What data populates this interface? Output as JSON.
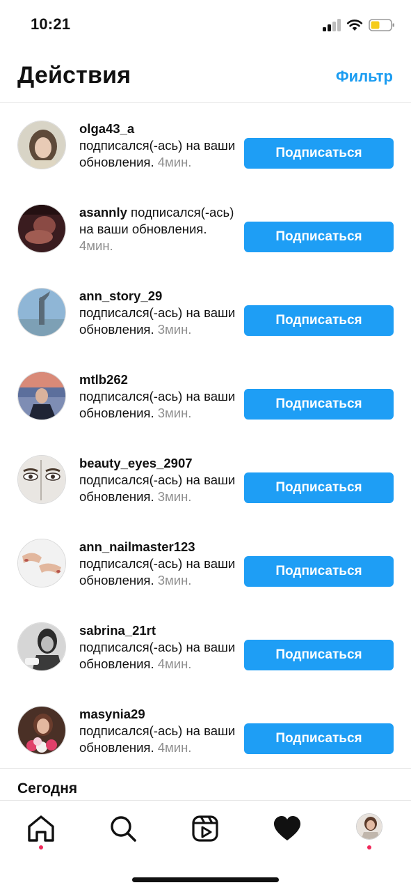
{
  "status_bar": {
    "time": "10:21",
    "icons": [
      "cellular-signal-icon",
      "wifi-icon",
      "battery-icon"
    ],
    "battery_color": "#f5cc1a"
  },
  "header": {
    "title": "Действия",
    "filter_label": "Фильтр"
  },
  "colors": {
    "accent": "#1e9ef5",
    "link": "#1a9cf1",
    "notification_dot": "#f0285a",
    "muted_text": "#8e8e8e"
  },
  "notifications": [
    {
      "username": "olga43_a",
      "action": "подписался(-ась) на ваши обновления.",
      "time": "4мин.",
      "button": "Подписаться"
    },
    {
      "username": "asannly",
      "action": "подписался(-ась) на ваши обновления.",
      "time": "4мин.",
      "button": "Подписаться"
    },
    {
      "username": "ann_story_29",
      "action": "подписался(-ась) на ваши обновления.",
      "time": "3мин.",
      "button": "Подписаться"
    },
    {
      "username": "mtlb262",
      "action": "подписался(-ась) на ваши обновления.",
      "time": "3мин.",
      "button": "Подписаться"
    },
    {
      "username": "beauty_eyes_2907",
      "action": "подписался(-ась) на ваши обновления.",
      "time": "3мин.",
      "button": "Подписаться"
    },
    {
      "username": "ann_nailmaster123",
      "action": "подписался(-ась) на ваши обновления.",
      "time": "3мин.",
      "button": "Подписаться"
    },
    {
      "username": "sabrina_21rt",
      "action": "подписался(-ась) на ваши обновления.",
      "time": "4мин.",
      "button": "Подписаться"
    },
    {
      "username": "masynia29",
      "action": "подписался(-ась) на ваши обновления.",
      "time": "4мин.",
      "button": "Подписаться"
    }
  ],
  "section": {
    "title": "Сегодня"
  },
  "tabbar": {
    "tabs": [
      "home-icon",
      "search-icon",
      "reels-icon",
      "heart-icon",
      "profile-avatar"
    ],
    "active_dots": [
      "home",
      "profile"
    ]
  }
}
